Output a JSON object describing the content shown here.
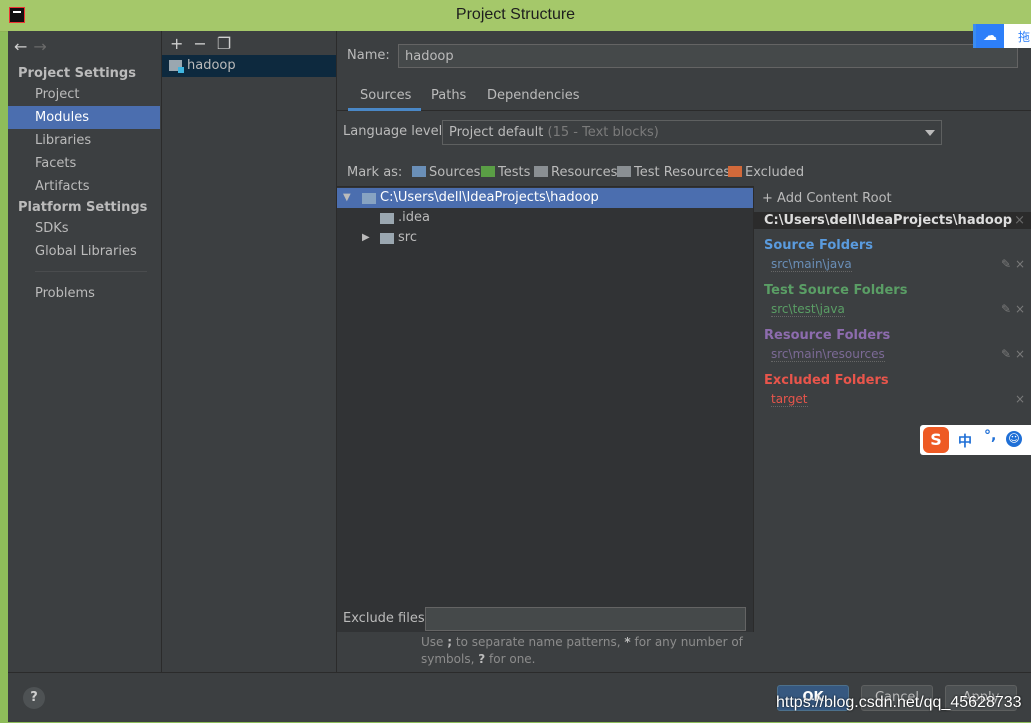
{
  "window": {
    "title": "Project Structure"
  },
  "nav": {
    "project_settings_header": "Project Settings",
    "platform_settings_header": "Platform Settings",
    "items": [
      {
        "label": "Project"
      },
      {
        "label": "Modules"
      },
      {
        "label": "Libraries"
      },
      {
        "label": "Facets"
      },
      {
        "label": "Artifacts"
      },
      {
        "label": "SDKs"
      },
      {
        "label": "Global Libraries"
      },
      {
        "label": "Problems"
      }
    ],
    "selected": "Modules"
  },
  "modules": {
    "toolbar": {
      "add": "+",
      "remove": "−",
      "copy": "❐"
    },
    "items": [
      {
        "label": "hadoop"
      }
    ]
  },
  "main": {
    "name_label": "Name:",
    "name_value": "hadoop",
    "tabs": [
      {
        "label": "Sources"
      },
      {
        "label": "Paths"
      },
      {
        "label": "Dependencies"
      }
    ],
    "active_tab": "Sources",
    "language_label": "Language level:",
    "language_value": "Project default",
    "language_hint": "(15 - Text blocks)",
    "mark_as_label": "Mark as:",
    "mark_as": [
      {
        "label": "Sources",
        "color": "#6a8fb8"
      },
      {
        "label": "Tests",
        "color": "#5a9e45"
      },
      {
        "label": "Resources",
        "color": "#8a8f93"
      },
      {
        "label": "Test Resources",
        "color": "#8a8f93"
      },
      {
        "label": "Excluded",
        "color": "#d2693a"
      }
    ],
    "tree": [
      {
        "label": "C:\\Users\\dell\\IdeaProjects\\hadoop",
        "expanded": true
      },
      {
        "label": ".idea"
      },
      {
        "label": "src",
        "expanded": false
      }
    ],
    "exclude_label": "Exclude files:",
    "exclude_value": "",
    "exclude_help_1": "Use",
    "exclude_help_sep": ";",
    "exclude_help_2": "to separate name patterns,",
    "exclude_help_star": "*",
    "exclude_help_3": "for any number of symbols,",
    "exclude_help_q": "?",
    "exclude_help_4": "for one."
  },
  "roots": {
    "add_label": "Add Content Root",
    "root_path": "C:\\Users\\dell\\IdeaProjects\\hadoop",
    "sections": [
      {
        "title": "Source Folders",
        "color": "#5a9bde",
        "path": "src\\main\\java",
        "path_color": "#6a8fb8"
      },
      {
        "title": "Test Source Folders",
        "color": "#5a9e65",
        "path": "src\\test\\java",
        "path_color": "#5a9e65"
      },
      {
        "title": "Resource Folders",
        "color": "#8d6cae",
        "path": "src\\main\\resources",
        "path_color": "#7c6a96"
      },
      {
        "title": "Excluded Folders",
        "color": "#e8554b",
        "path": "target",
        "path_color": "#e8554b"
      }
    ]
  },
  "footer": {
    "help": "?",
    "ok": "OK",
    "cancel": "Cancel",
    "apply": "Apply"
  },
  "overlays": {
    "cloud_text": "拖",
    "ime_s": "S",
    "ime_zh": "中",
    "ime_punct": "°,",
    "watermark": "https://blog.csdn.net/qq_45628733"
  }
}
